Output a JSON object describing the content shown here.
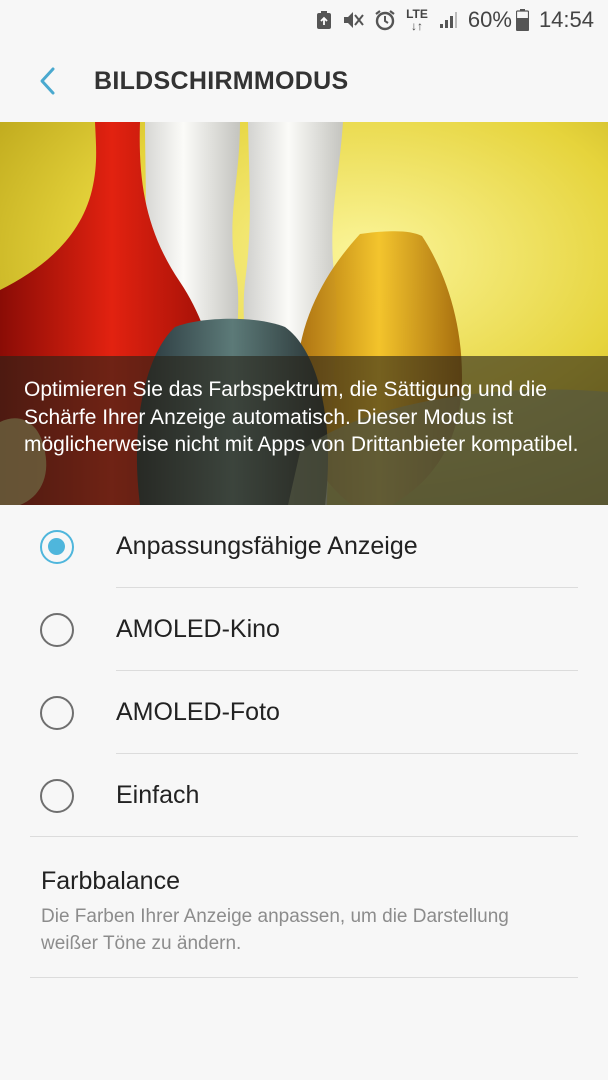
{
  "status_bar": {
    "network": "LTE",
    "battery_percent": "60%",
    "time": "14:54",
    "icons": [
      "recycle-notification-icon",
      "mute-icon",
      "alarm-icon",
      "lte-icon",
      "signal-icon",
      "battery-icon"
    ]
  },
  "header": {
    "title": "BILDSCHIRMMODUS",
    "back_icon": "chevron-left-icon"
  },
  "hero": {
    "caption": "Optimieren Sie das Farbspektrum, die Sättigung und die Schärfe Ihrer Anzeige automatisch. Dieser Modus ist möglicherweise nicht mit Apps von Drittanbieter kompatibel."
  },
  "modes": {
    "selected_index": 0,
    "items": [
      {
        "label": "Anpassungsfähige Anzeige",
        "selected": true
      },
      {
        "label": "AMOLED-Kino",
        "selected": false
      },
      {
        "label": "AMOLED-Foto",
        "selected": false
      },
      {
        "label": "Einfach",
        "selected": false
      }
    ]
  },
  "color_balance": {
    "title": "Farbbalance",
    "description": "Die Farben Ihrer Anzeige anpassen, um die Darstellung weißer Töne zu ändern."
  },
  "colors": {
    "accent": "#4fb6dc",
    "background": "#f7f7f7",
    "secondary_text": "#8c8c8c"
  }
}
